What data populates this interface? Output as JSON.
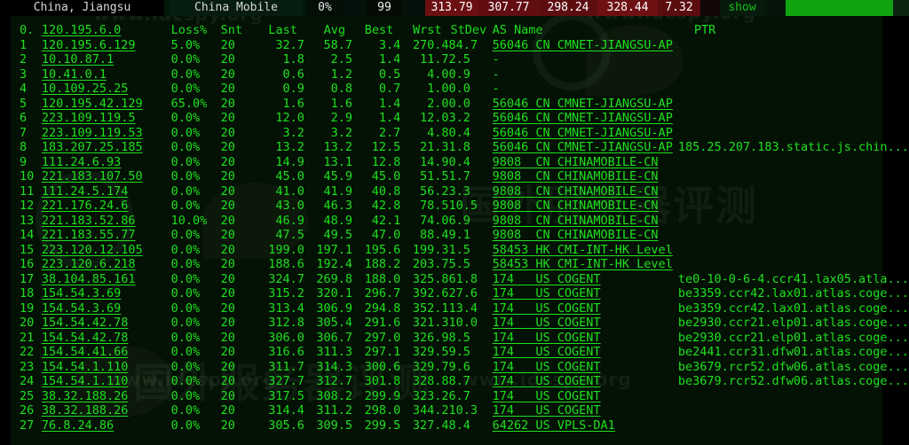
{
  "statusbar": {
    "location": "China, Jiangsu",
    "isp": "China Mobile",
    "loss": "0%",
    "snt": "99",
    "last": "313.79",
    "avg": "307.77",
    "best": "298.24",
    "worst": "328.44",
    "stdev": "7.32",
    "show_label": "show",
    "progress_percent": 87,
    "colors": {
      "red_segment": "#6b0f12",
      "green_bar": "#11a411",
      "terminal_green": "#1ee01e",
      "terminal_bg": "#041105"
    }
  },
  "table": {
    "headers": {
      "index": "0.",
      "host": "120.195.6.0",
      "loss": "Loss%",
      "snt": "Snt",
      "last": "Last",
      "avg": "Avg",
      "best": "Best",
      "worst": "Wrst",
      "stdev": "StDev",
      "as_name": "AS Name",
      "ptr": "PTR"
    },
    "rows": [
      {
        "idx": "1",
        "host": "120.195.6.129",
        "loss": "5.0%",
        "snt": "20",
        "last": "32.7",
        "avg": "58.7",
        "best": "3.4",
        "wrst": "270.4",
        "sd": "84.7",
        "as": "56046 CN CMNET-JIANGSU-AP",
        "ptr": ""
      },
      {
        "idx": "2",
        "host": "10.10.87.1",
        "loss": "0.0%",
        "snt": "20",
        "last": "1.8",
        "avg": "2.5",
        "best": "1.4",
        "wrst": "11.7",
        "sd": "2.5",
        "as": "-",
        "ptr": ""
      },
      {
        "idx": "3",
        "host": "10.41.0.1",
        "loss": "0.0%",
        "snt": "20",
        "last": "0.6",
        "avg": "1.2",
        "best": "0.5",
        "wrst": "4.0",
        "sd": "0.9",
        "as": "-",
        "ptr": ""
      },
      {
        "idx": "4",
        "host": "10.109.25.25",
        "loss": "0.0%",
        "snt": "20",
        "last": "0.9",
        "avg": "0.8",
        "best": "0.7",
        "wrst": "1.0",
        "sd": "0.0",
        "as": "-",
        "ptr": ""
      },
      {
        "idx": "5",
        "host": "120.195.42.129",
        "loss": "65.0%",
        "snt": "20",
        "last": "1.6",
        "avg": "1.6",
        "best": "1.4",
        "wrst": "2.0",
        "sd": "0.0",
        "as": "56046 CN CMNET-JIANGSU-AP",
        "ptr": ""
      },
      {
        "idx": "6",
        "host": "223.109.119.5",
        "loss": "0.0%",
        "snt": "20",
        "last": "12.0",
        "avg": "2.9",
        "best": "1.4",
        "wrst": "12.0",
        "sd": "3.2",
        "as": "56046 CN CMNET-JIANGSU-AP",
        "ptr": ""
      },
      {
        "idx": "7",
        "host": "223.109.119.53",
        "loss": "0.0%",
        "snt": "20",
        "last": "3.2",
        "avg": "3.2",
        "best": "2.7",
        "wrst": "4.8",
        "sd": "0.4",
        "as": "56046 CN CMNET-JIANGSU-AP",
        "ptr": ""
      },
      {
        "idx": "8",
        "host": "183.207.25.185",
        "loss": "0.0%",
        "snt": "20",
        "last": "13.2",
        "avg": "13.2",
        "best": "12.5",
        "wrst": "21.3",
        "sd": "1.8",
        "as": "56046 CN CMNET-JIANGSU-AP",
        "ptr": "185.25.207.183.static.js.chin..."
      },
      {
        "idx": "9",
        "host": "111.24.6.93",
        "loss": "0.0%",
        "snt": "20",
        "last": "14.9",
        "avg": "13.1",
        "best": "12.8",
        "wrst": "14.9",
        "sd": "0.4",
        "as": "9808  CN CHINAMOBILE-CN",
        "ptr": ""
      },
      {
        "idx": "10",
        "host": "221.183.107.50",
        "loss": "0.0%",
        "snt": "20",
        "last": "45.0",
        "avg": "45.9",
        "best": "45.0",
        "wrst": "51.5",
        "sd": "1.7",
        "as": "9808  CN CHINAMOBILE-CN",
        "ptr": ""
      },
      {
        "idx": "11",
        "host": "111.24.5.174",
        "loss": "0.0%",
        "snt": "20",
        "last": "41.0",
        "avg": "41.9",
        "best": "40.8",
        "wrst": "56.2",
        "sd": "3.3",
        "as": "9808  CN CHINAMOBILE-CN",
        "ptr": ""
      },
      {
        "idx": "12",
        "host": "221.176.24.6",
        "loss": "0.0%",
        "snt": "20",
        "last": "43.0",
        "avg": "46.3",
        "best": "42.8",
        "wrst": "78.5",
        "sd": "10.5",
        "as": "9808  CN CHINAMOBILE-CN",
        "ptr": ""
      },
      {
        "idx": "13",
        "host": "221.183.52.86",
        "loss": "10.0%",
        "snt": "20",
        "last": "46.9",
        "avg": "48.9",
        "best": "42.1",
        "wrst": "74.0",
        "sd": "6.9",
        "as": "9808  CN CHINAMOBILE-CN",
        "ptr": ""
      },
      {
        "idx": "14",
        "host": "221.183.55.77",
        "loss": "0.0%",
        "snt": "20",
        "last": "47.5",
        "avg": "49.5",
        "best": "47.0",
        "wrst": "88.4",
        "sd": "9.1",
        "as": "9808  CN CHINAMOBILE-CN",
        "ptr": ""
      },
      {
        "idx": "15",
        "host": "223.120.12.105",
        "loss": "0.0%",
        "snt": "20",
        "last": "199.0",
        "avg": "197.1",
        "best": "195.6",
        "wrst": "199.3",
        "sd": "1.5",
        "as": "58453 HK CMI-INT-HK Level",
        "ptr": ""
      },
      {
        "idx": "16",
        "host": "223.120.6.218",
        "loss": "0.0%",
        "snt": "20",
        "last": "188.6",
        "avg": "192.4",
        "best": "188.2",
        "wrst": "203.7",
        "sd": "5.5",
        "as": "58453 HK CMI-INT-HK Level",
        "ptr": ""
      },
      {
        "idx": "17",
        "host": "38.104.85.161",
        "loss": "0.0%",
        "snt": "20",
        "last": "324.7",
        "avg": "269.8",
        "best": "188.0",
        "wrst": "325.8",
        "sd": "61.8",
        "as": "174   US COGENT",
        "ptr": "te0-10-0-6-4.ccr41.lax05.atla..."
      },
      {
        "idx": "18",
        "host": "154.54.3.69",
        "loss": "0.0%",
        "snt": "20",
        "last": "315.2",
        "avg": "320.1",
        "best": "296.7",
        "wrst": "392.6",
        "sd": "27.6",
        "as": "174   US COGENT",
        "ptr": "be3359.ccr42.lax01.atlas.coge..."
      },
      {
        "idx": "19",
        "host": "154.54.3.69",
        "loss": "0.0%",
        "snt": "20",
        "last": "313.4",
        "avg": "306.9",
        "best": "294.8",
        "wrst": "352.1",
        "sd": "13.4",
        "as": "174   US COGENT",
        "ptr": "be3359.ccr42.lax01.atlas.coge..."
      },
      {
        "idx": "20",
        "host": "154.54.42.78",
        "loss": "0.0%",
        "snt": "20",
        "last": "312.8",
        "avg": "305.4",
        "best": "291.6",
        "wrst": "321.3",
        "sd": "10.0",
        "as": "174   US COGENT",
        "ptr": "be2930.ccr21.elp01.atlas.coge..."
      },
      {
        "idx": "21",
        "host": "154.54.42.78",
        "loss": "0.0%",
        "snt": "20",
        "last": "306.0",
        "avg": "306.7",
        "best": "297.0",
        "wrst": "326.9",
        "sd": "8.5",
        "as": "174   US COGENT",
        "ptr": "be2930.ccr21.elp01.atlas.coge..."
      },
      {
        "idx": "22",
        "host": "154.54.41.66",
        "loss": "0.0%",
        "snt": "20",
        "last": "316.6",
        "avg": "311.3",
        "best": "297.1",
        "wrst": "329.5",
        "sd": "9.5",
        "as": "174   US COGENT",
        "ptr": "be2441.ccr31.dfw01.atlas.coge..."
      },
      {
        "idx": "23",
        "host": "154.54.1.110",
        "loss": "0.0%",
        "snt": "20",
        "last": "311.7",
        "avg": "314.3",
        "best": "300.6",
        "wrst": "329.7",
        "sd": "9.6",
        "as": "174   US COGENT",
        "ptr": "be3679.rcr52.dfw06.atlas.coge..."
      },
      {
        "idx": "24",
        "host": "154.54.1.110",
        "loss": "0.0%",
        "snt": "20",
        "last": "327.7",
        "avg": "312.7",
        "best": "301.8",
        "wrst": "328.8",
        "sd": "8.7",
        "as": "174   US COGENT",
        "ptr": "be3679.rcr52.dfw06.atlas.coge..."
      },
      {
        "idx": "25",
        "host": "38.32.188.26",
        "loss": "0.0%",
        "snt": "20",
        "last": "317.5",
        "avg": "308.2",
        "best": "299.9",
        "wrst": "323.2",
        "sd": "6.7",
        "as": "174   US COGENT",
        "ptr": ""
      },
      {
        "idx": "26",
        "host": "38.32.188.26",
        "loss": "0.0%",
        "snt": "20",
        "last": "314.4",
        "avg": "311.2",
        "best": "298.0",
        "wrst": "344.2",
        "sd": "10.3",
        "as": "174   US COGENT",
        "ptr": ""
      },
      {
        "idx": "27",
        "host": "76.8.24.86",
        "loss": "0.0%",
        "snt": "20",
        "last": "305.6",
        "avg": "309.5",
        "best": "299.5",
        "wrst": "327.4",
        "sd": "8.4",
        "as": "64262 US VPLS-DA1",
        "ptr": ""
      }
    ]
  },
  "watermarks": {
    "site_url": "www.idcspy.org",
    "brand_cn": "国外服务器评测"
  }
}
